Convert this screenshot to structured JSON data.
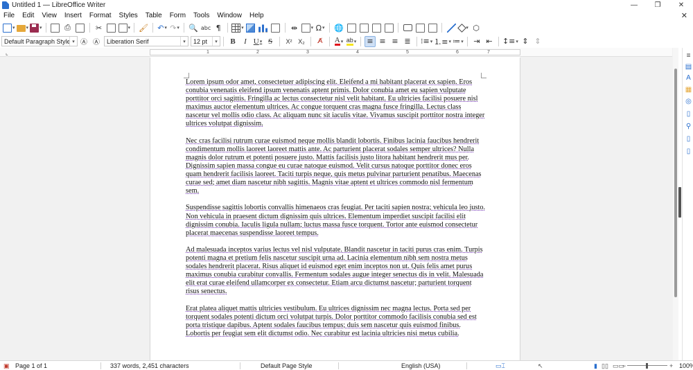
{
  "window": {
    "title": "Untitled 1 — LibreOffice Writer",
    "controls": [
      "—",
      "❐",
      "✕"
    ]
  },
  "menubar": {
    "items": [
      "File",
      "Edit",
      "View",
      "Insert",
      "Format",
      "Styles",
      "Table",
      "Form",
      "Tools",
      "Window",
      "Help"
    ],
    "close_doc": "✕"
  },
  "formatting": {
    "paragraph_style": "Default Paragraph Style",
    "font_name": "Liberation Serif",
    "font_size": "12 pt",
    "bold": "B",
    "italic": "I",
    "underline": "U",
    "strikethrough": "S",
    "superscript": "X²",
    "subscript": "X₂",
    "font_color": "A",
    "highlight": "ab",
    "align_active": "left"
  },
  "colors": {
    "accent": "#2a6fce",
    "font_color_swatch": "#e0141c",
    "highlight_swatch": "#f7e51c",
    "spellcheck_underline": "#6b2bb0"
  },
  "ruler": {
    "marks": [
      "1",
      "2",
      "3",
      "4",
      "5",
      "6",
      "7"
    ]
  },
  "document": {
    "paragraphs": [
      "Lorem ipsum odor amet, consectetuer adipiscing elit. Eleifend a mi habitant placerat ex sapien. Eros conubia venenatis eleifend ipsum venenatis aptent primis. Dolor conubia amet eu sapien vulputate porttitor orci sagittis. Fringilla ac lectus consectetur nisl velit habitant. Eu ultricies facilisi posuere nisl maximus auctor elementum ultrices. Ac congue torquent cras magna fusce fringilla. Lectus class nascetur vel mollis odio class. Ac aliquam nunc sit iaculis vitae. Vivamus suscipit porttitor nostra integer ultrices volutpat dignissim.",
      "Nec cras facilisi rutrum curae euismod neque mollis blandit lobortis. Finibus lacinia faucibus hendrerit condimentum mollis laoreet laoreet mattis ante. Ac parturient placerat sodales semper ultrices? Nulla magnis dolor rutrum et potenti posuere justo. Mattis facilisis justo litora habitant hendrerit mus per. Dignissim sapien massa congue eu curae natoque euismod. Velit cursus natoque porttitor donec eros quam hendrerit facilisis laoreet. Taciti turpis neque, quis metus pulvinar parturient penatibus. Maecenas curae sed; amet diam nascetur nibh sagittis. Magnis vitae aptent et ultrices commodo nisl fermentum sem.",
      "Suspendisse sagittis lobortis convallis himenaeos cras feugiat. Per taciti sapien nostra; vehicula leo justo. Non vehicula in praesent dictum dignissim quis ultrices. Elementum imperdiet suscipit facilisi elit dignissim conubia. Iaculis ligula nullam; luctus massa fusce torquent. Tortor ante euismod consectetur placerat maecenas suspendisse laoreet tempus.",
      "Ad malesuada inceptos varius lectus vel nisl vulputate. Blandit nascetur in taciti purus cras enim. Turpis potenti magna et pretium felis nascetur suscipit urna ad. Lacinia elementum nibh sem nostra metus sodales hendrerit placerat. Risus aliquet id euismod eget enim inceptos non ut. Quis felis amet purus maximus conubia curabitur convallis. Fermentum sodales augue integer senectus dis in velit. Malesuada elit erat curae eleifend ullamcorper ex consectetur. Etiam arcu dictumst nascetur; parturient torquent risus senectus.",
      "Erat platea aliquet mattis ultricies vestibulum. Eu ultrices dignissim nec magna lectus. Porta sed per torquent sodales potenti dictum orci volutpat turpis. Dolor porttitor commodo facilisis conubia sed est porta tristique dapibus. Aptent sodales faucibus tempus; duis sem nascetur quis euismod finibus. Lobortis per feugiat sem elit dictumst odio. Nec curabitur est lacinia ultricies nisi metus cubilia."
    ]
  },
  "statusbar": {
    "page": "Page 1 of 1",
    "words": "337 words, 2,451 characters",
    "page_style": "Default Page Style",
    "language": "English (USA)",
    "zoom": "100%"
  }
}
